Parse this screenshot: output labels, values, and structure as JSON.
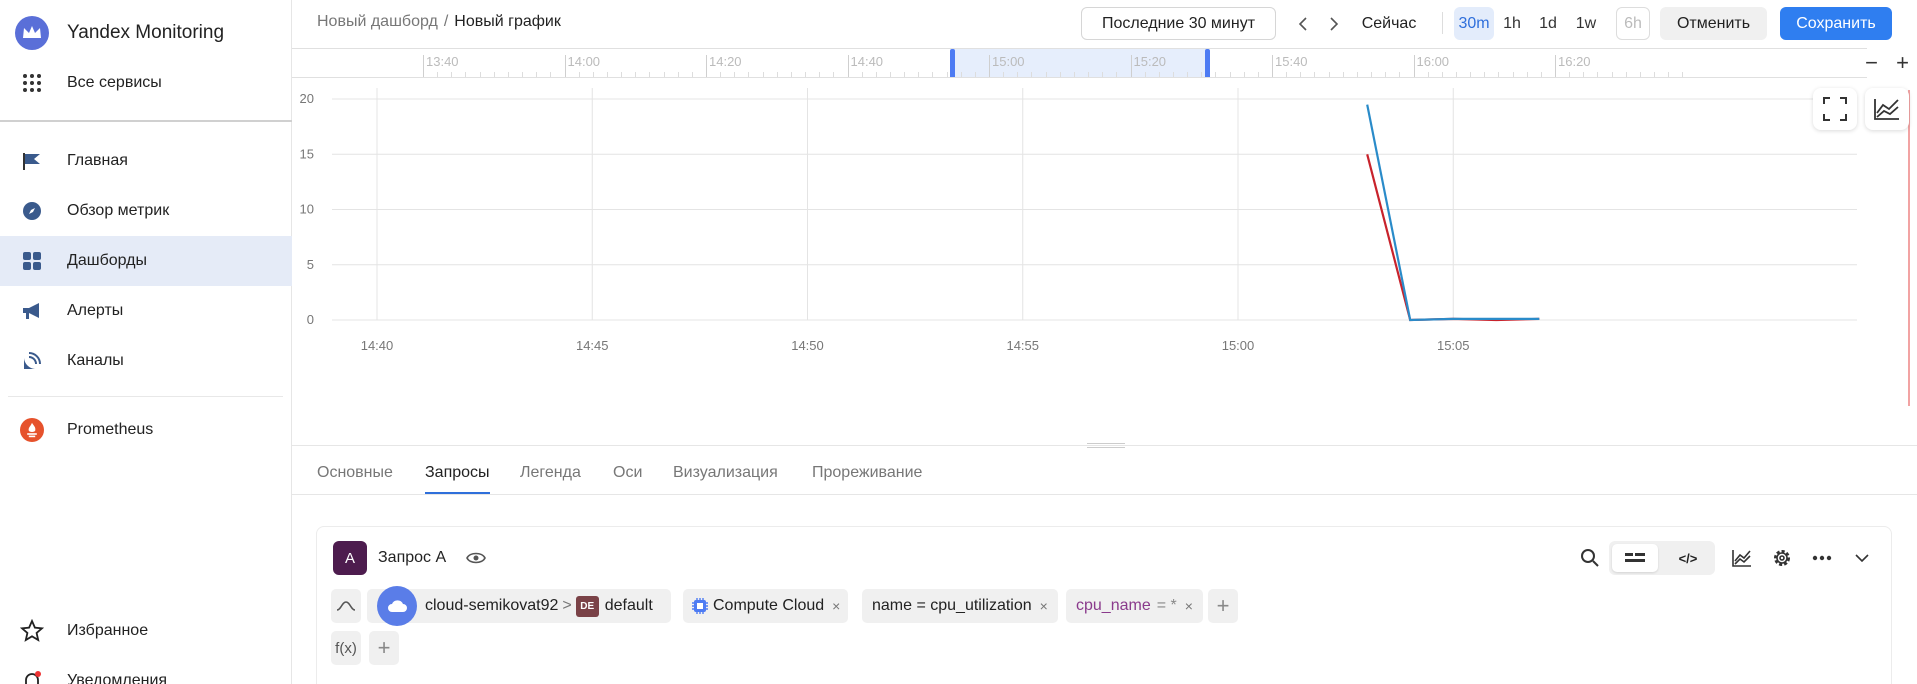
{
  "app": {
    "name": "Yandex Monitoring"
  },
  "sidebar": {
    "all_services": "Все сервисы",
    "items": [
      {
        "label": "Главная",
        "icon": "flag-icon"
      },
      {
        "label": "Обзор метрик",
        "icon": "compass-icon"
      },
      {
        "label": "Дашборды",
        "icon": "dashboard-icon",
        "active": true
      },
      {
        "label": "Алерты",
        "icon": "megaphone-icon"
      },
      {
        "label": "Каналы",
        "icon": "satellite-icon"
      }
    ],
    "prometheus": "Prometheus",
    "favorites": "Избранное",
    "notifications": "Уведомления"
  },
  "breadcrumb": {
    "parent": "Новый дашборд",
    "separator": "/",
    "current": "Новый график"
  },
  "header": {
    "range_label": "Последние 30 минут",
    "now_label": "Сейчас",
    "time_buttons": [
      {
        "label": "30m",
        "state": "active"
      },
      {
        "label": "1h",
        "state": "normal"
      },
      {
        "label": "1d",
        "state": "normal"
      },
      {
        "label": "1w",
        "state": "normal"
      },
      {
        "label": "6h",
        "state": "disabled"
      }
    ],
    "cancel_label": "Отменить",
    "save_label": "Сохранить"
  },
  "timeline": {
    "labels": [
      "13:40",
      "14:00",
      "14:20",
      "14:40",
      "15:00",
      "15:20",
      "15:40",
      "16:00",
      "16:20"
    ],
    "zoom_out": "−",
    "zoom_in": "+"
  },
  "chart_data": {
    "type": "line",
    "x_ticks": [
      "14:40",
      "14:45",
      "14:50",
      "14:55",
      "15:00",
      "15:05"
    ],
    "y_ticks": [
      0,
      5,
      10,
      15,
      20
    ],
    "ylim": [
      0,
      21
    ],
    "series": [
      {
        "color": "#2a8bc9",
        "points": [
          [
            "15:03",
            19.5
          ],
          [
            "15:04",
            0
          ],
          [
            "15:05",
            0.1
          ],
          [
            "15:06",
            0.1
          ],
          [
            "15:07",
            0.1
          ]
        ]
      },
      {
        "color": "#c8232c",
        "points": [
          [
            "15:03",
            15
          ],
          [
            "15:04",
            0
          ],
          [
            "15:05",
            0.1
          ],
          [
            "15:06",
            0
          ],
          [
            "15:07",
            0.1
          ]
        ]
      }
    ]
  },
  "tabs": [
    "Основные",
    "Запросы",
    "Легенда",
    "Оси",
    "Визуализация",
    "Прореживание"
  ],
  "active_tab": "Запросы",
  "query": {
    "badge": "A",
    "title": "Запрос A",
    "folder": "cloud-semikovat92",
    "folder_sep": ">",
    "badge_de": "DE",
    "env": "default",
    "service": "Compute Cloud",
    "name_filter": "name = cpu_utilization",
    "label_key": "cpu_name",
    "label_op": "= *",
    "fx": "f(x)",
    "add": "+",
    "remove": "×",
    "mode_code": "</>"
  }
}
